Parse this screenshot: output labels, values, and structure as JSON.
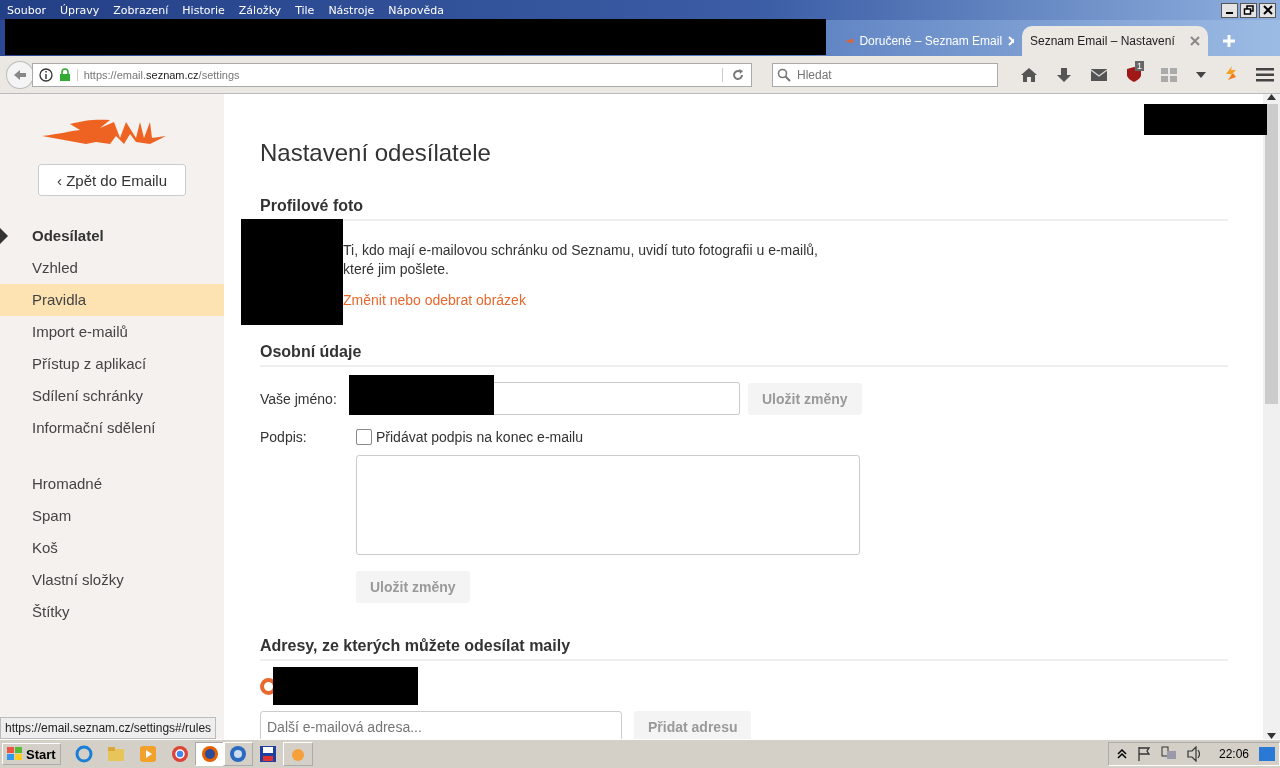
{
  "menu_bar": [
    "Soubor",
    "Úpravy",
    "Zobrazení",
    "Historie",
    "Záložky",
    "Tile",
    "Nástroje",
    "Nápověda"
  ],
  "tabs": [
    {
      "title": "Doručené – Seznam Email",
      "selected": false
    },
    {
      "title": "Seznam Email – Nastavení",
      "selected": true
    }
  ],
  "address_bar": {
    "url": "https://email.**seznam.cz**/settings"
  },
  "search": {
    "placeholder": "Hledat"
  },
  "addon_badge": "1",
  "sidebar": {
    "back_button": "‹ Zpět do Emailu",
    "groups": [
      [
        {
          "label": "Odesílatel",
          "selected": true,
          "highlighted": false
        },
        {
          "label": "Vzhled",
          "selected": false,
          "highlighted": false
        },
        {
          "label": "Pravidla",
          "selected": false,
          "highlighted": true
        },
        {
          "label": "Import e-mailů",
          "selected": false,
          "highlighted": false
        },
        {
          "label": "Přístup z aplikací",
          "selected": false,
          "highlighted": false
        },
        {
          "label": "Sdílení schránky",
          "selected": false,
          "highlighted": false
        },
        {
          "label": "Informační sdělení",
          "selected": false,
          "highlighted": false
        }
      ],
      [
        {
          "label": "Hromadné",
          "selected": false,
          "highlighted": false
        },
        {
          "label": "Spam",
          "selected": false,
          "highlighted": false
        },
        {
          "label": "Koš",
          "selected": false,
          "highlighted": false
        },
        {
          "label": "Vlastní složky",
          "selected": false,
          "highlighted": false
        },
        {
          "label": "Štítky",
          "selected": false,
          "highlighted": false
        }
      ]
    ]
  },
  "page": {
    "title": "Nastavení odesílatele",
    "profile_photo": {
      "heading": "Profilové foto",
      "text": "Ti, kdo mají e-mailovou schránku od Seznamu, uvidí tuto fotografii u e-mailů, které jim pošlete.",
      "link": "Změnit nebo odebrat obrázek"
    },
    "personal": {
      "heading": "Osobní údaje",
      "name_label": "Vaše jméno:",
      "save_button": "Uložit změny",
      "signature_label": "Podpis:",
      "signature_checkbox": {
        "label": "Přidávat podpis na konec e-mailu",
        "checked": false
      },
      "signature_save_button": "Uložit změny"
    },
    "addresses": {
      "heading": "Adresy, ze kterých můžete odesílat maily",
      "radio_selected": true,
      "new_address": {
        "placeholder": "Další e-mailová adresa..."
      },
      "add_button": "Přidat adresu"
    }
  },
  "status_url": "https://email.seznam.cz/settings#/rules",
  "taskbar": {
    "start": "Start",
    "clock": "22:06"
  }
}
